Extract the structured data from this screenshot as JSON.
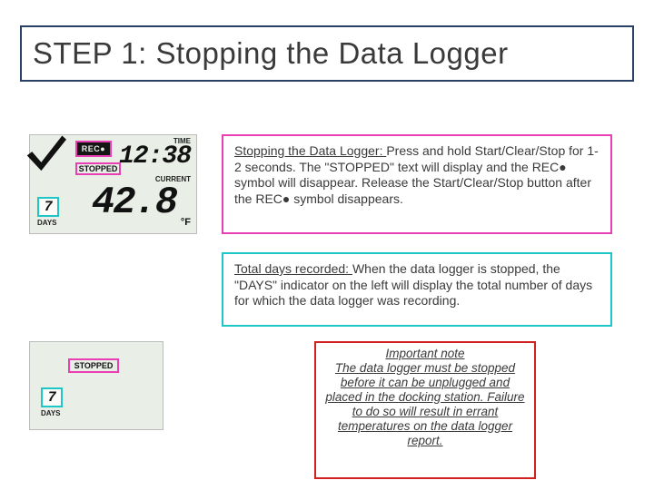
{
  "title": "STEP 1: Stopping the Data Logger",
  "lcd1": {
    "rec": "REC●",
    "time_label": "TIME",
    "time": "12:38",
    "stopped": "STOPPED",
    "current_label": "CURRENT",
    "temp": "42.8",
    "unit": "°F",
    "days": "7",
    "days_label": "DAYS"
  },
  "lcd2": {
    "stopped": "STOPPED",
    "days": "7",
    "days_label": "DAYS"
  },
  "inst1": {
    "lead": "Stopping the Data Logger: ",
    "body": "Press and hold Start/Clear/Stop for 1-2 seconds. The \"STOPPED\" text will display and the REC● symbol will disappear. Release the Start/Clear/Stop button after the REC● symbol disappears."
  },
  "inst2": {
    "lead": "Total days recorded: ",
    "body": "When the data logger is stopped, the \"DAYS\" indicator on the left will display the total number of days for which the data logger was recording."
  },
  "warn": {
    "lead": "Important note",
    "body": "The data logger must be stopped before it can be unplugged and placed in the docking station. Failure to do so will result in errant temperatures on the data logger report."
  }
}
